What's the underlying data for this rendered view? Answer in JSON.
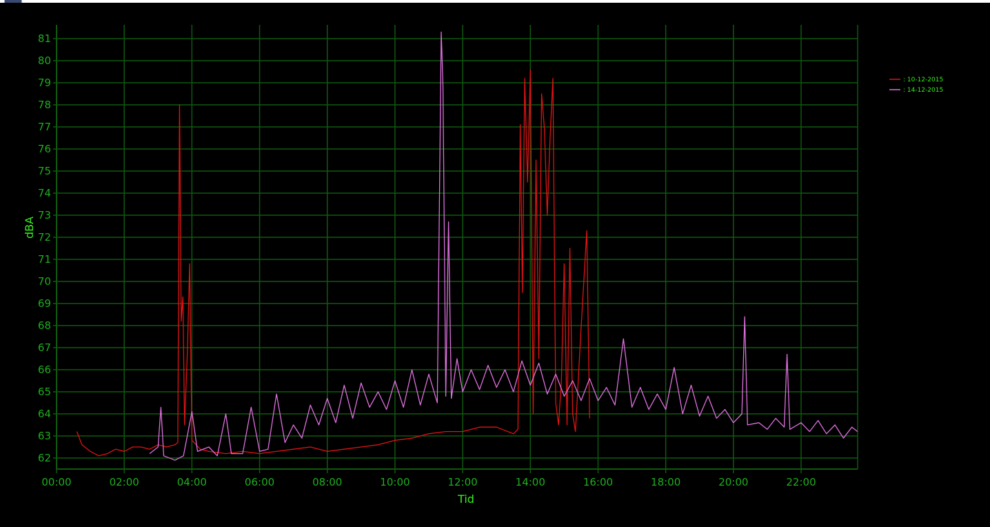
{
  "window": {
    "icon": "app-icon"
  },
  "colors": {
    "background": "#000000",
    "grid": "#0f5a0f",
    "axis_text": "#1fae1f",
    "title_text": "#39f01f",
    "series_1": "#e01414",
    "series_2": "#e070e0"
  },
  "chart_data": {
    "type": "line",
    "title": "",
    "xlabel": "Tid",
    "ylabel": "dBA",
    "xlim_hours": [
      0,
      23.67
    ],
    "ylim": [
      61.5,
      81.5
    ],
    "x_ticks": [
      "00:00",
      "02:00",
      "04:00",
      "06:00",
      "08:00",
      "10:00",
      "12:00",
      "14:00",
      "16:00",
      "18:00",
      "20:00",
      "22:00"
    ],
    "y_ticks": [
      62,
      63,
      64,
      65,
      66,
      67,
      68,
      69,
      70,
      71,
      72,
      73,
      74,
      75,
      76,
      77,
      78,
      79,
      80,
      81
    ],
    "grid": true,
    "legend_position": "top-right",
    "series": [
      {
        "name": ": 10-12-2015",
        "color": "#e01414",
        "points": [
          [
            "00:36",
            63.2
          ],
          [
            "00:45",
            62.6
          ],
          [
            "01:00",
            62.3
          ],
          [
            "01:15",
            62.1
          ],
          [
            "01:30",
            62.2
          ],
          [
            "01:45",
            62.4
          ],
          [
            "02:00",
            62.3
          ],
          [
            "02:15",
            62.5
          ],
          [
            "02:30",
            62.5
          ],
          [
            "02:45",
            62.4
          ],
          [
            "03:00",
            62.6
          ],
          [
            "03:15",
            62.5
          ],
          [
            "03:30",
            62.6
          ],
          [
            "03:35",
            62.7
          ],
          [
            "03:38",
            78.0
          ],
          [
            "03:41",
            68.2
          ],
          [
            "03:44",
            69.3
          ],
          [
            "03:47",
            63.5
          ],
          [
            "03:52",
            66.8
          ],
          [
            "03:56",
            70.8
          ],
          [
            "04:00",
            62.8
          ],
          [
            "04:15",
            62.4
          ],
          [
            "04:30",
            62.3
          ],
          [
            "05:00",
            62.2
          ],
          [
            "05:30",
            62.3
          ],
          [
            "06:00",
            62.2
          ],
          [
            "06:30",
            62.3
          ],
          [
            "07:00",
            62.4
          ],
          [
            "07:30",
            62.5
          ],
          [
            "08:00",
            62.3
          ],
          [
            "08:30",
            62.4
          ],
          [
            "09:00",
            62.5
          ],
          [
            "09:30",
            62.6
          ],
          [
            "10:00",
            62.8
          ],
          [
            "10:30",
            62.9
          ],
          [
            "11:00",
            63.1
          ],
          [
            "11:30",
            63.2
          ],
          [
            "12:00",
            63.2
          ],
          [
            "12:30",
            63.4
          ],
          [
            "13:00",
            63.4
          ],
          [
            "13:30",
            63.1
          ],
          [
            "13:38",
            63.3
          ],
          [
            "13:42",
            77.1
          ],
          [
            "13:46",
            69.5
          ],
          [
            "13:50",
            79.2
          ],
          [
            "13:55",
            74.5
          ],
          [
            "14:00",
            79.6
          ],
          [
            "14:05",
            64.0
          ],
          [
            "14:10",
            75.5
          ],
          [
            "14:15",
            66.5
          ],
          [
            "14:20",
            78.5
          ],
          [
            "14:25",
            76.9
          ],
          [
            "14:30",
            73.0
          ],
          [
            "14:35",
            76.5
          ],
          [
            "14:40",
            79.2
          ],
          [
            "14:45",
            64.5
          ],
          [
            "14:50",
            63.5
          ],
          [
            "14:55",
            65.5
          ],
          [
            "15:00",
            70.8
          ],
          [
            "15:05",
            63.5
          ],
          [
            "15:10",
            71.5
          ],
          [
            "15:15",
            64.0
          ],
          [
            "15:20",
            63.2
          ],
          [
            "15:30",
            67.9
          ],
          [
            "15:40",
            72.3
          ],
          [
            "15:45",
            63.8
          ]
        ]
      },
      {
        "name": ": 14-12-2015",
        "color": "#e070e0",
        "points": [
          [
            "02:45",
            62.2
          ],
          [
            "03:00",
            62.5
          ],
          [
            "03:05",
            64.3
          ],
          [
            "03:10",
            62.1
          ],
          [
            "03:30",
            61.9
          ],
          [
            "03:45",
            62.1
          ],
          [
            "04:00",
            64.1
          ],
          [
            "04:10",
            62.3
          ],
          [
            "04:30",
            62.5
          ],
          [
            "04:45",
            62.1
          ],
          [
            "05:00",
            64.0
          ],
          [
            "05:10",
            62.2
          ],
          [
            "05:30",
            62.2
          ],
          [
            "05:45",
            64.3
          ],
          [
            "06:00",
            62.3
          ],
          [
            "06:15",
            62.4
          ],
          [
            "06:30",
            64.9
          ],
          [
            "06:45",
            62.7
          ],
          [
            "07:00",
            63.5
          ],
          [
            "07:15",
            62.9
          ],
          [
            "07:30",
            64.4
          ],
          [
            "07:45",
            63.5
          ],
          [
            "08:00",
            64.7
          ],
          [
            "08:15",
            63.6
          ],
          [
            "08:30",
            65.3
          ],
          [
            "08:45",
            63.8
          ],
          [
            "09:00",
            65.4
          ],
          [
            "09:15",
            64.3
          ],
          [
            "09:30",
            65.0
          ],
          [
            "09:45",
            64.2
          ],
          [
            "10:00",
            65.5
          ],
          [
            "10:15",
            64.3
          ],
          [
            "10:30",
            66.0
          ],
          [
            "10:45",
            64.4
          ],
          [
            "11:00",
            65.8
          ],
          [
            "11:15",
            64.5
          ],
          [
            "11:22",
            81.3
          ],
          [
            "11:25",
            78.9
          ],
          [
            "11:30",
            64.8
          ],
          [
            "11:35",
            72.7
          ],
          [
            "11:40",
            64.7
          ],
          [
            "11:50",
            66.5
          ],
          [
            "12:00",
            65.0
          ],
          [
            "12:15",
            66.0
          ],
          [
            "12:30",
            65.1
          ],
          [
            "12:45",
            66.2
          ],
          [
            "13:00",
            65.2
          ],
          [
            "13:15",
            66.0
          ],
          [
            "13:30",
            65.0
          ],
          [
            "13:45",
            66.4
          ],
          [
            "14:00",
            65.3
          ],
          [
            "14:15",
            66.3
          ],
          [
            "14:30",
            64.9
          ],
          [
            "14:45",
            65.8
          ],
          [
            "15:00",
            64.8
          ],
          [
            "15:15",
            65.5
          ],
          [
            "15:30",
            64.6
          ],
          [
            "15:45",
            65.6
          ],
          [
            "16:00",
            64.6
          ],
          [
            "16:15",
            65.2
          ],
          [
            "16:30",
            64.4
          ],
          [
            "16:45",
            67.4
          ],
          [
            "17:00",
            64.3
          ],
          [
            "17:15",
            65.2
          ],
          [
            "17:30",
            64.2
          ],
          [
            "17:45",
            64.9
          ],
          [
            "18:00",
            64.2
          ],
          [
            "18:15",
            66.1
          ],
          [
            "18:30",
            64.0
          ],
          [
            "18:45",
            65.3
          ],
          [
            "19:00",
            63.9
          ],
          [
            "19:15",
            64.8
          ],
          [
            "19:30",
            63.8
          ],
          [
            "19:45",
            64.2
          ],
          [
            "20:00",
            63.6
          ],
          [
            "20:15",
            64.0
          ],
          [
            "20:20",
            68.4
          ],
          [
            "20:25",
            63.5
          ],
          [
            "20:45",
            63.6
          ],
          [
            "21:00",
            63.3
          ],
          [
            "21:15",
            63.8
          ],
          [
            "21:30",
            63.4
          ],
          [
            "21:35",
            66.7
          ],
          [
            "21:40",
            63.3
          ],
          [
            "22:00",
            63.6
          ],
          [
            "22:15",
            63.2
          ],
          [
            "22:30",
            63.7
          ],
          [
            "22:45",
            63.1
          ],
          [
            "23:00",
            63.5
          ],
          [
            "23:15",
            62.9
          ],
          [
            "23:30",
            63.4
          ],
          [
            "23:40",
            63.2
          ]
        ]
      }
    ]
  }
}
